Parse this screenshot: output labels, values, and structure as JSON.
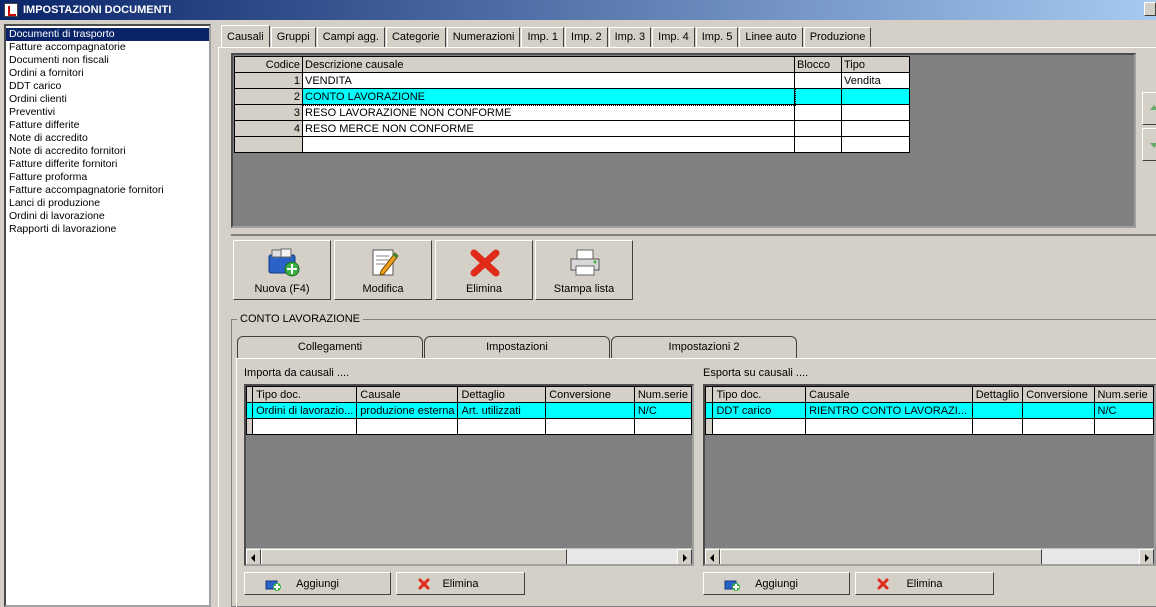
{
  "window": {
    "title": "IMPOSTAZIONI DOCUMENTI"
  },
  "sidebar": {
    "items": [
      "Documenti di trasporto",
      "Fatture accompagnatorie",
      "Documenti non fiscali",
      "Ordini a fornitori",
      "DDT carico",
      "Ordini clienti",
      "Preventivi",
      "Fatture differite",
      "Note di accredito",
      "Note di accredito fornitori",
      "Fatture differite fornitori",
      "Fatture proforma",
      "Fatture accompagnatorie fornitori",
      "Lanci di produzione",
      "Ordini di lavorazione",
      "Rapporti di lavorazione"
    ],
    "selected_index": 0
  },
  "tabs": [
    "Causali",
    "Gruppi",
    "Campi agg.",
    "Categorie",
    "Numerazioni",
    "Imp. 1",
    "Imp. 2",
    "Imp. 3",
    "Imp. 4",
    "Imp. 5",
    "Linee auto",
    "Produzione"
  ],
  "active_tab": "Causali",
  "causali_grid": {
    "headers": {
      "codice": "Codice",
      "descrizione": "Descrizione causale",
      "blocco": "Blocco",
      "tipo": "Tipo"
    },
    "rows": [
      {
        "codice": "1",
        "descrizione": "VENDITA",
        "blocco": "",
        "tipo": "Vendita"
      },
      {
        "codice": "2",
        "descrizione": "CONTO LAVORAZIONE",
        "blocco": "",
        "tipo": ""
      },
      {
        "codice": "3",
        "descrizione": "RESO LAVORAZIONE NON CONFORME",
        "blocco": "",
        "tipo": ""
      },
      {
        "codice": "4",
        "descrizione": "RESO MERCE NON CONFORME",
        "blocco": "",
        "tipo": ""
      }
    ],
    "selected_row": 1
  },
  "toolbar": {
    "nuova": "Nuova (F4)",
    "modifica": "Modifica",
    "elimina": "Elimina",
    "stampa": "Stampa lista"
  },
  "detail": {
    "group_title": "CONTO LAVORAZIONE",
    "subtabs": [
      "Collegamenti",
      "Impostazioni",
      "Impostazioni 2"
    ],
    "active_subtab": "Collegamenti",
    "importa": {
      "label": "Importa da causali ....",
      "headers": [
        "Tipo doc.",
        "Causale",
        "Dettaglio",
        "Conversione",
        "Num.serie"
      ],
      "rows": [
        [
          "Ordini di lavorazio...",
          "produzione esterna",
          "Art. utilizzati",
          "",
          "N/C"
        ]
      ],
      "add_button": "Aggiungi",
      "delete_button": "Elimina"
    },
    "esporta": {
      "label": "Esporta su causali ....",
      "headers": [
        "Tipo doc.",
        "Causale",
        "Dettaglio",
        "Conversione",
        "Num.serie"
      ],
      "rows": [
        [
          "DDT carico",
          "RIENTRO CONTO LAVORAZI...",
          "",
          "",
          "N/C"
        ]
      ],
      "add_button": "Aggiungi",
      "delete_button": "Elimina"
    }
  },
  "colors": {
    "selection": "#0a246a",
    "highlight_row": "#00ffff",
    "grid_background": "#808080"
  },
  "icons": [
    "new-document-icon",
    "edit-document-icon",
    "delete-x-icon",
    "printer-icon",
    "add-icon",
    "arrow-up-icon",
    "arrow-down-icon"
  ]
}
